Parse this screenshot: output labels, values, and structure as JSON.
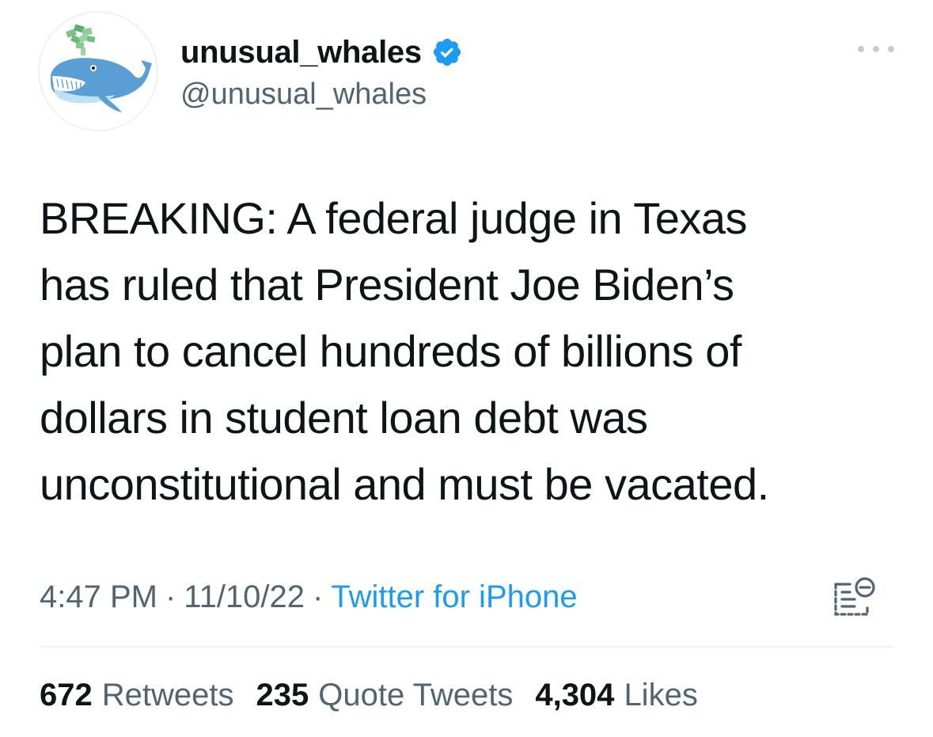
{
  "author": {
    "display_name": "unusual_whales",
    "handle": "@unusual_whales",
    "verified": true,
    "avatar_icon": "whale-money-avatar"
  },
  "tweet": {
    "lines": [
      "BREAKING: A federal judge in Texas",
      "has ruled that President Joe Biden’s",
      "plan to cancel hundreds of billions of",
      "dollars in student loan debt was",
      "unconstitutional and must be vacated."
    ]
  },
  "meta": {
    "time": "4:47 PM",
    "separator": "·",
    "date": "11/10/22",
    "source": "Twitter for iPhone"
  },
  "stats": {
    "retweets": {
      "count": "672",
      "label": "Retweets"
    },
    "quote_tweets": {
      "count": "235",
      "label": "Quote Tweets"
    },
    "likes": {
      "count": "4,304",
      "label": "Likes"
    }
  },
  "colors": {
    "text_primary": "#0f1419",
    "text_secondary": "#536471",
    "accent": "#1d9bf0",
    "verified_badge": "#1d9bf0"
  }
}
